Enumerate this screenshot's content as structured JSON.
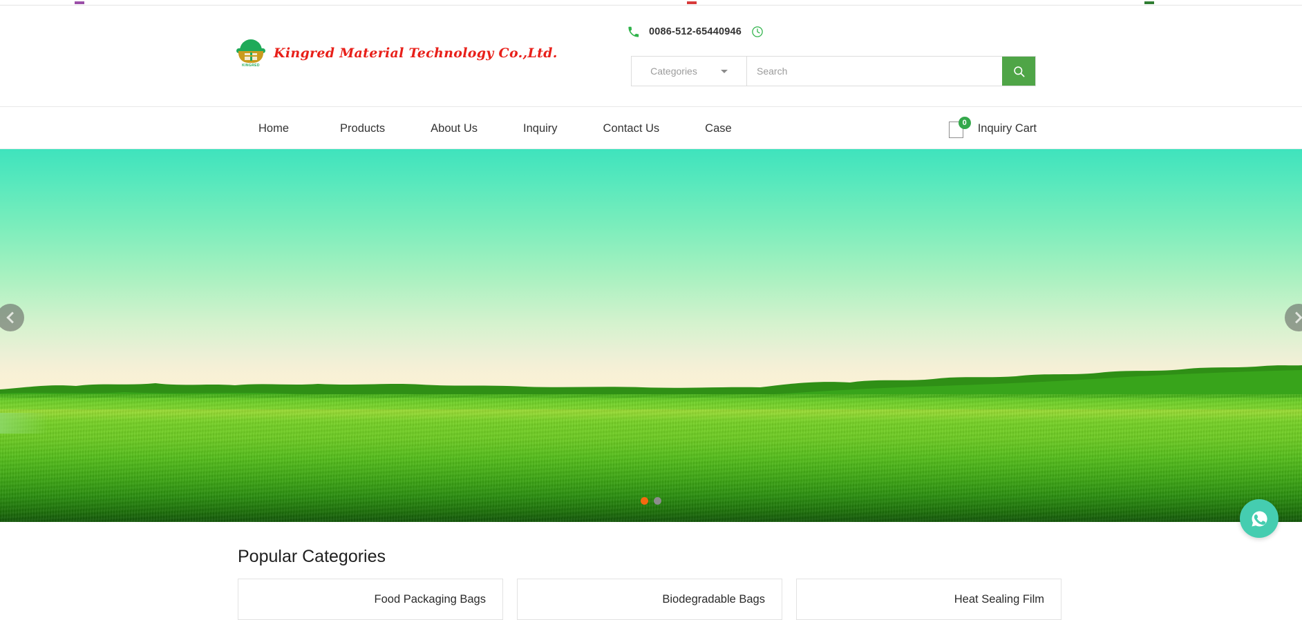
{
  "brand": {
    "logo_text": "Kingred Material Technology Co.,Ltd.",
    "logo_mark_name": "kingred-logo-mark",
    "logo_sub": "KINGRED",
    "logo_red": "#e8201a",
    "logo_green": "#1faa59",
    "logo_gold": "#c99b1e"
  },
  "header": {
    "phone_icon": "phone-icon",
    "phone": "0086-512-65440946",
    "clock_icon": "clock-icon",
    "search": {
      "category_label": "Categories",
      "category_caret": "chevron-down-icon",
      "placeholder": "Search",
      "value": "",
      "button_icon": "search-icon",
      "button_color": "#4fa547"
    }
  },
  "nav": {
    "items": [
      {
        "label": "Home"
      },
      {
        "label": "Products"
      },
      {
        "label": "About Us"
      },
      {
        "label": "Inquiry"
      },
      {
        "label": "Contact Us"
      },
      {
        "label": "Case"
      }
    ],
    "cart": {
      "icon": "inquiry-cart-icon",
      "badge_count": "0",
      "badge_color": "#34a84b",
      "label": "Inquiry Cart"
    }
  },
  "hero": {
    "prev_icon": "chevron-left-icon",
    "next_icon": "chevron-right-icon",
    "slides_total": 2,
    "active_slide": 1,
    "dot_active_color": "#f4690f",
    "dot_inactive_color": "#8c8c8c",
    "image_description": "green rolling meadow with tree line and teal sky"
  },
  "floating": {
    "whatsapp_icon": "whatsapp-icon",
    "whatsapp_color": "#45cdb0"
  },
  "popular": {
    "title": "Popular Categories",
    "cards": [
      {
        "label": "Food Packaging Bags"
      },
      {
        "label": "Biodegradable Bags"
      },
      {
        "label": "Heat Sealing Film"
      }
    ]
  }
}
